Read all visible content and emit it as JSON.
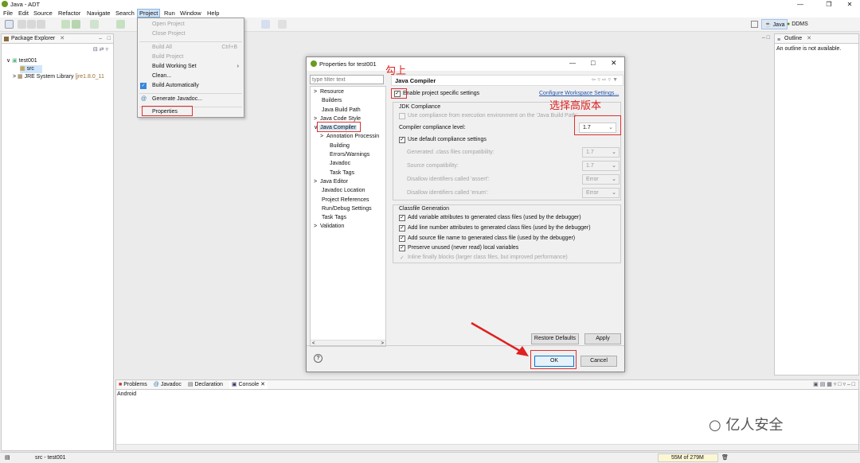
{
  "window": {
    "title": "Java - ADT"
  },
  "menubar": [
    "File",
    "Edit",
    "Source",
    "Refactor",
    "Navigate",
    "Search",
    "Project",
    "Run",
    "Window",
    "Help"
  ],
  "perspectives": {
    "java": "Java",
    "ddms": "DDMS"
  },
  "project_menu": {
    "items": [
      {
        "label": "Open Project",
        "enabled": false
      },
      {
        "label": "Close Project",
        "enabled": false
      },
      {
        "label": "Build All",
        "shortcut": "Ctrl+B",
        "enabled": false
      },
      {
        "label": "Build Project",
        "enabled": false
      },
      {
        "label": "Build Working Set",
        "enabled": true
      },
      {
        "label": "Clean...",
        "enabled": true
      },
      {
        "label": "Build Automatically",
        "enabled": true,
        "checked": true
      },
      {
        "label": "Generate Javadoc...",
        "enabled": true
      },
      {
        "label": "Properties",
        "enabled": true
      }
    ]
  },
  "package_explorer": {
    "title": "Package Explorer",
    "project": "test001",
    "src": "src",
    "jre": "JRE System Library",
    "jre_version": "[jre1.8.0_11"
  },
  "outline": {
    "title": "Outline",
    "message": "An outline is not available."
  },
  "dialog": {
    "title": "Properties for test001",
    "filter_placeholder": "type filter text",
    "tree": [
      "Resource",
      "Builders",
      "Java Build Path",
      "Java Code Style",
      "Java Compiler",
      "Annotation Processin",
      "Building",
      "Errors/Warnings",
      "Javadoc",
      "Task Tags",
      "Java Editor",
      "Javadoc Location",
      "Project References",
      "Run/Debug Settings",
      "Task Tags",
      "Validation"
    ],
    "page_title": "Java Compiler",
    "enable_specific": "Enable project specific settings",
    "configure_link": "Configure Workspace Settings...",
    "jdk_group": "JDK Compliance",
    "use_exec_env": "Use compliance from execution environment on the 'Java Build Path'",
    "compliance_label": "Compiler compliance level:",
    "compliance_value": "1.7",
    "use_default": "Use default compliance settings",
    "generated_label": "Generated .class files compatibility:",
    "generated_value": "1.7",
    "source_label": "Source compatibility:",
    "source_value": "1.7",
    "assert_label": "Disallow identifiers called 'assert':",
    "assert_value": "Error",
    "enum_label": "Disallow identifiers called 'enum':",
    "enum_value": "Error",
    "classfile_group": "Classfile Generation",
    "classfile_options": [
      "Add variable attributes to generated class files (used by the debugger)",
      "Add line number attributes to generated class files (used by the debugger)",
      "Add source file name to generated class file (used by the debugger)",
      "Preserve unused (never read) local variables",
      "Inline finally blocks (larger class files, but improved performance)"
    ],
    "restore_defaults": "Restore Defaults",
    "apply": "Apply",
    "ok": "OK",
    "cancel": "Cancel"
  },
  "annotations": {
    "check_note": "勾上",
    "version_note": "选择高版本"
  },
  "console": {
    "tabs": [
      "Problems",
      "Javadoc",
      "Declaration",
      "Console"
    ],
    "content": "Android"
  },
  "watermark": "亿人安全",
  "status": {
    "path": "src - test001",
    "memory": "55M of 279M"
  }
}
